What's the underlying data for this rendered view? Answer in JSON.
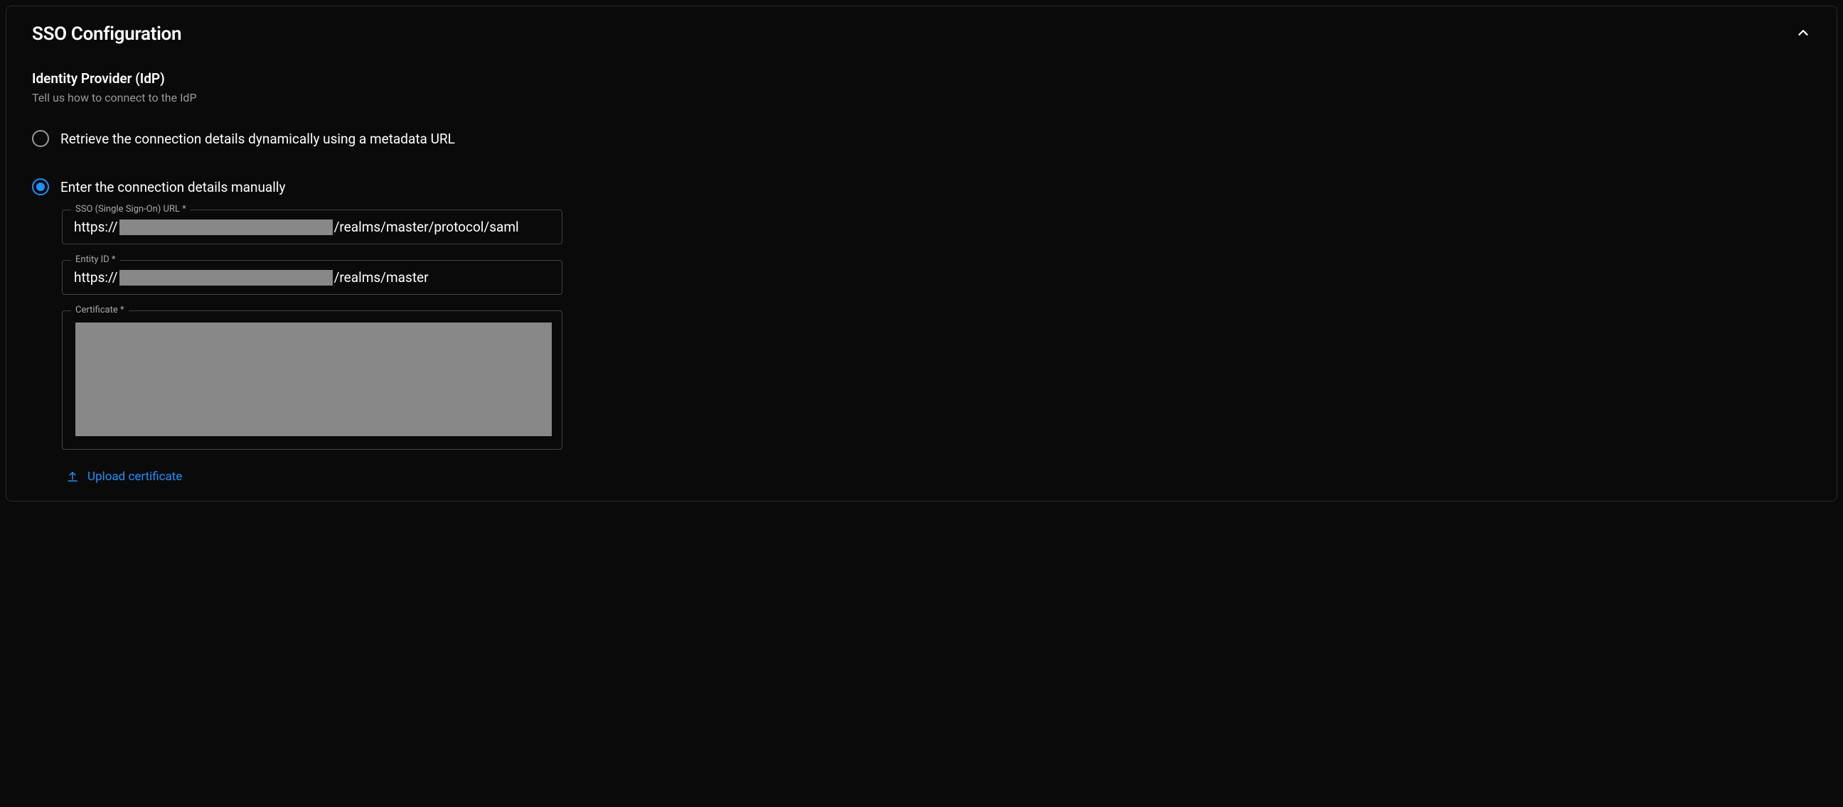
{
  "panel": {
    "title": "SSO Configuration"
  },
  "idp": {
    "heading": "Identity Provider (IdP)",
    "subheading": "Tell us how to connect to the IdP"
  },
  "radios": {
    "metadata_url": {
      "label": "Retrieve the connection details dynamically using a metadata URL",
      "selected": false
    },
    "manual": {
      "label": "Enter the connection details manually",
      "selected": true
    }
  },
  "fields": {
    "sso_url": {
      "label": "SSO (Single Sign-On) URL *",
      "prefix": "https://",
      "suffix": "/realms/master/protocol/saml"
    },
    "entity_id": {
      "label": "Entity ID *",
      "prefix": "https://",
      "suffix": "/realms/master"
    },
    "certificate": {
      "label": "Certificate *"
    }
  },
  "upload": {
    "label": "Upload certificate"
  }
}
